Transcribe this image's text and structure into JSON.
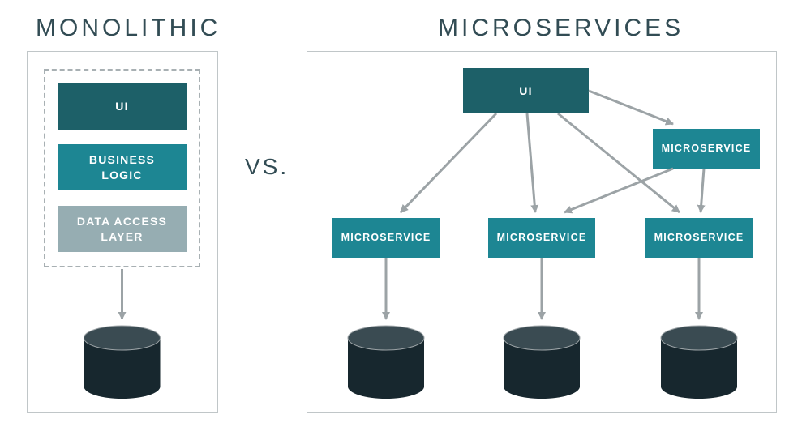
{
  "titles": {
    "left": "MONOLITHIC",
    "right": "MICROSERVICES",
    "vs": "VS."
  },
  "colors": {
    "arrow": "#9ca3a6",
    "cylinder_side": "#17272e",
    "cylinder_top": "#3a4b52",
    "cylinder_stroke": "#9ca3a6",
    "teal_dark": "#1d6068",
    "teal": "#1d8693",
    "teal_light": "#96adb2"
  },
  "monolithic": {
    "layers": [
      {
        "label": "UI",
        "color": "teal-dark"
      },
      {
        "label": "BUSINESS\nLOGIC",
        "color": "teal"
      },
      {
        "label": "DATA ACCESS\nLAYER",
        "color": "teal-light"
      }
    ]
  },
  "microservices": {
    "ui_label": "UI",
    "ms_label": "MICROSERVICE",
    "services_row": [
      {
        "label": "MICROSERVICE"
      },
      {
        "label": "MICROSERVICE"
      },
      {
        "label": "MICROSERVICE"
      }
    ],
    "top_right": {
      "label": "MICROSERVICE"
    }
  }
}
